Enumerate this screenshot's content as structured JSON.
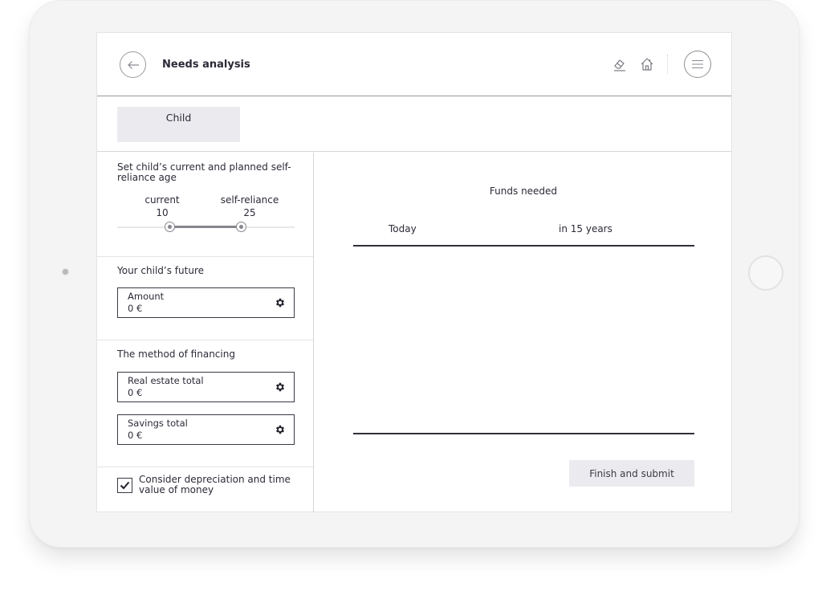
{
  "header": {
    "title": "Needs analysis",
    "back_icon": "arrow-left-icon",
    "icons": [
      "eraser-icon",
      "home-icon",
      "menu-icon"
    ]
  },
  "tabs": [
    {
      "label": "Child",
      "active": true
    }
  ],
  "age_section": {
    "title": "Set child’s current and planned self-reliance age",
    "current_label": "current",
    "current_value": "10",
    "self_reliance_label": "self-reliance",
    "self_reliance_value": "25"
  },
  "future_section": {
    "title": "Your child’s future",
    "fields": [
      {
        "label": "Amount",
        "value": "0 €",
        "icon": "gear-icon"
      }
    ]
  },
  "financing_section": {
    "title": "The method of financing",
    "fields": [
      {
        "label": "Real estate total",
        "value": "0 €",
        "icon": "gear-icon"
      },
      {
        "label": "Savings total",
        "value": "0 €",
        "icon": "gear-icon"
      }
    ]
  },
  "depreciation": {
    "label": "Consider depreciation and time value of money",
    "checked": true
  },
  "funds": {
    "title": "Funds needed",
    "col_today": "Today",
    "col_later": "in 15 years"
  },
  "actions": {
    "submit_label": "Finish and submit"
  }
}
